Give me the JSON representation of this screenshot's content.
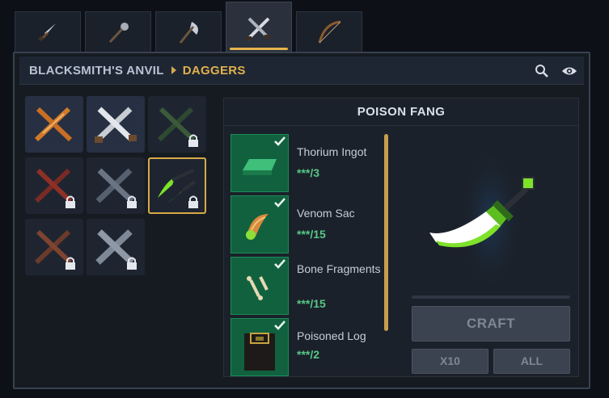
{
  "tabs": [
    {
      "name": "dagger-tab",
      "icon": "dagger-icon",
      "active": false
    },
    {
      "name": "mace-tab",
      "icon": "mace-icon",
      "active": false
    },
    {
      "name": "axe-tab",
      "icon": "axe-icon",
      "active": false
    },
    {
      "name": "crossed-weapons-tab",
      "icon": "crossed-swords-icon",
      "active": true
    },
    {
      "name": "bow-tab",
      "icon": "bow-icon",
      "active": false
    }
  ],
  "breadcrumb": {
    "root": "BLACKSMITH'S ANVIL",
    "current": "DAGGERS"
  },
  "toolbar": {
    "search_icon": "search-icon",
    "view_icon": "eye-icon"
  },
  "colors": {
    "accent_gold": "#e0b14d",
    "material_green": "#11613f",
    "check_green": "#57c886",
    "poison_green": "#7ee22a"
  },
  "grid_items": [
    {
      "name": "dagger-pair-1",
      "locked": false,
      "selected": false
    },
    {
      "name": "dagger-pair-2",
      "locked": false,
      "selected": false
    },
    {
      "name": "dagger-pair-3",
      "locked": true,
      "selected": false
    },
    {
      "name": "dagger-pair-4",
      "locked": true,
      "selected": false
    },
    {
      "name": "dagger-pair-5",
      "locked": true,
      "selected": false
    },
    {
      "name": "poison-fang",
      "locked": true,
      "selected": true
    },
    {
      "name": "dagger-pair-7",
      "locked": true,
      "selected": false
    },
    {
      "name": "dagger-pair-8",
      "locked": true,
      "selected": false
    }
  ],
  "detail": {
    "title": "POISON FANG",
    "materials": [
      {
        "name": "Thorium Ingot",
        "count": "***/3",
        "icon": "ingot-icon"
      },
      {
        "name": "Venom Sac",
        "count": "***/15",
        "icon": "venom-sac-icon"
      },
      {
        "name": "Bone Fragments",
        "count": "***/15",
        "icon": "bone-icon"
      },
      {
        "name": "Poisoned Log",
        "count": "***/2",
        "icon": "log-icon"
      }
    ],
    "craft_label": "CRAFT",
    "x10_label": "X10",
    "all_label": "ALL"
  }
}
